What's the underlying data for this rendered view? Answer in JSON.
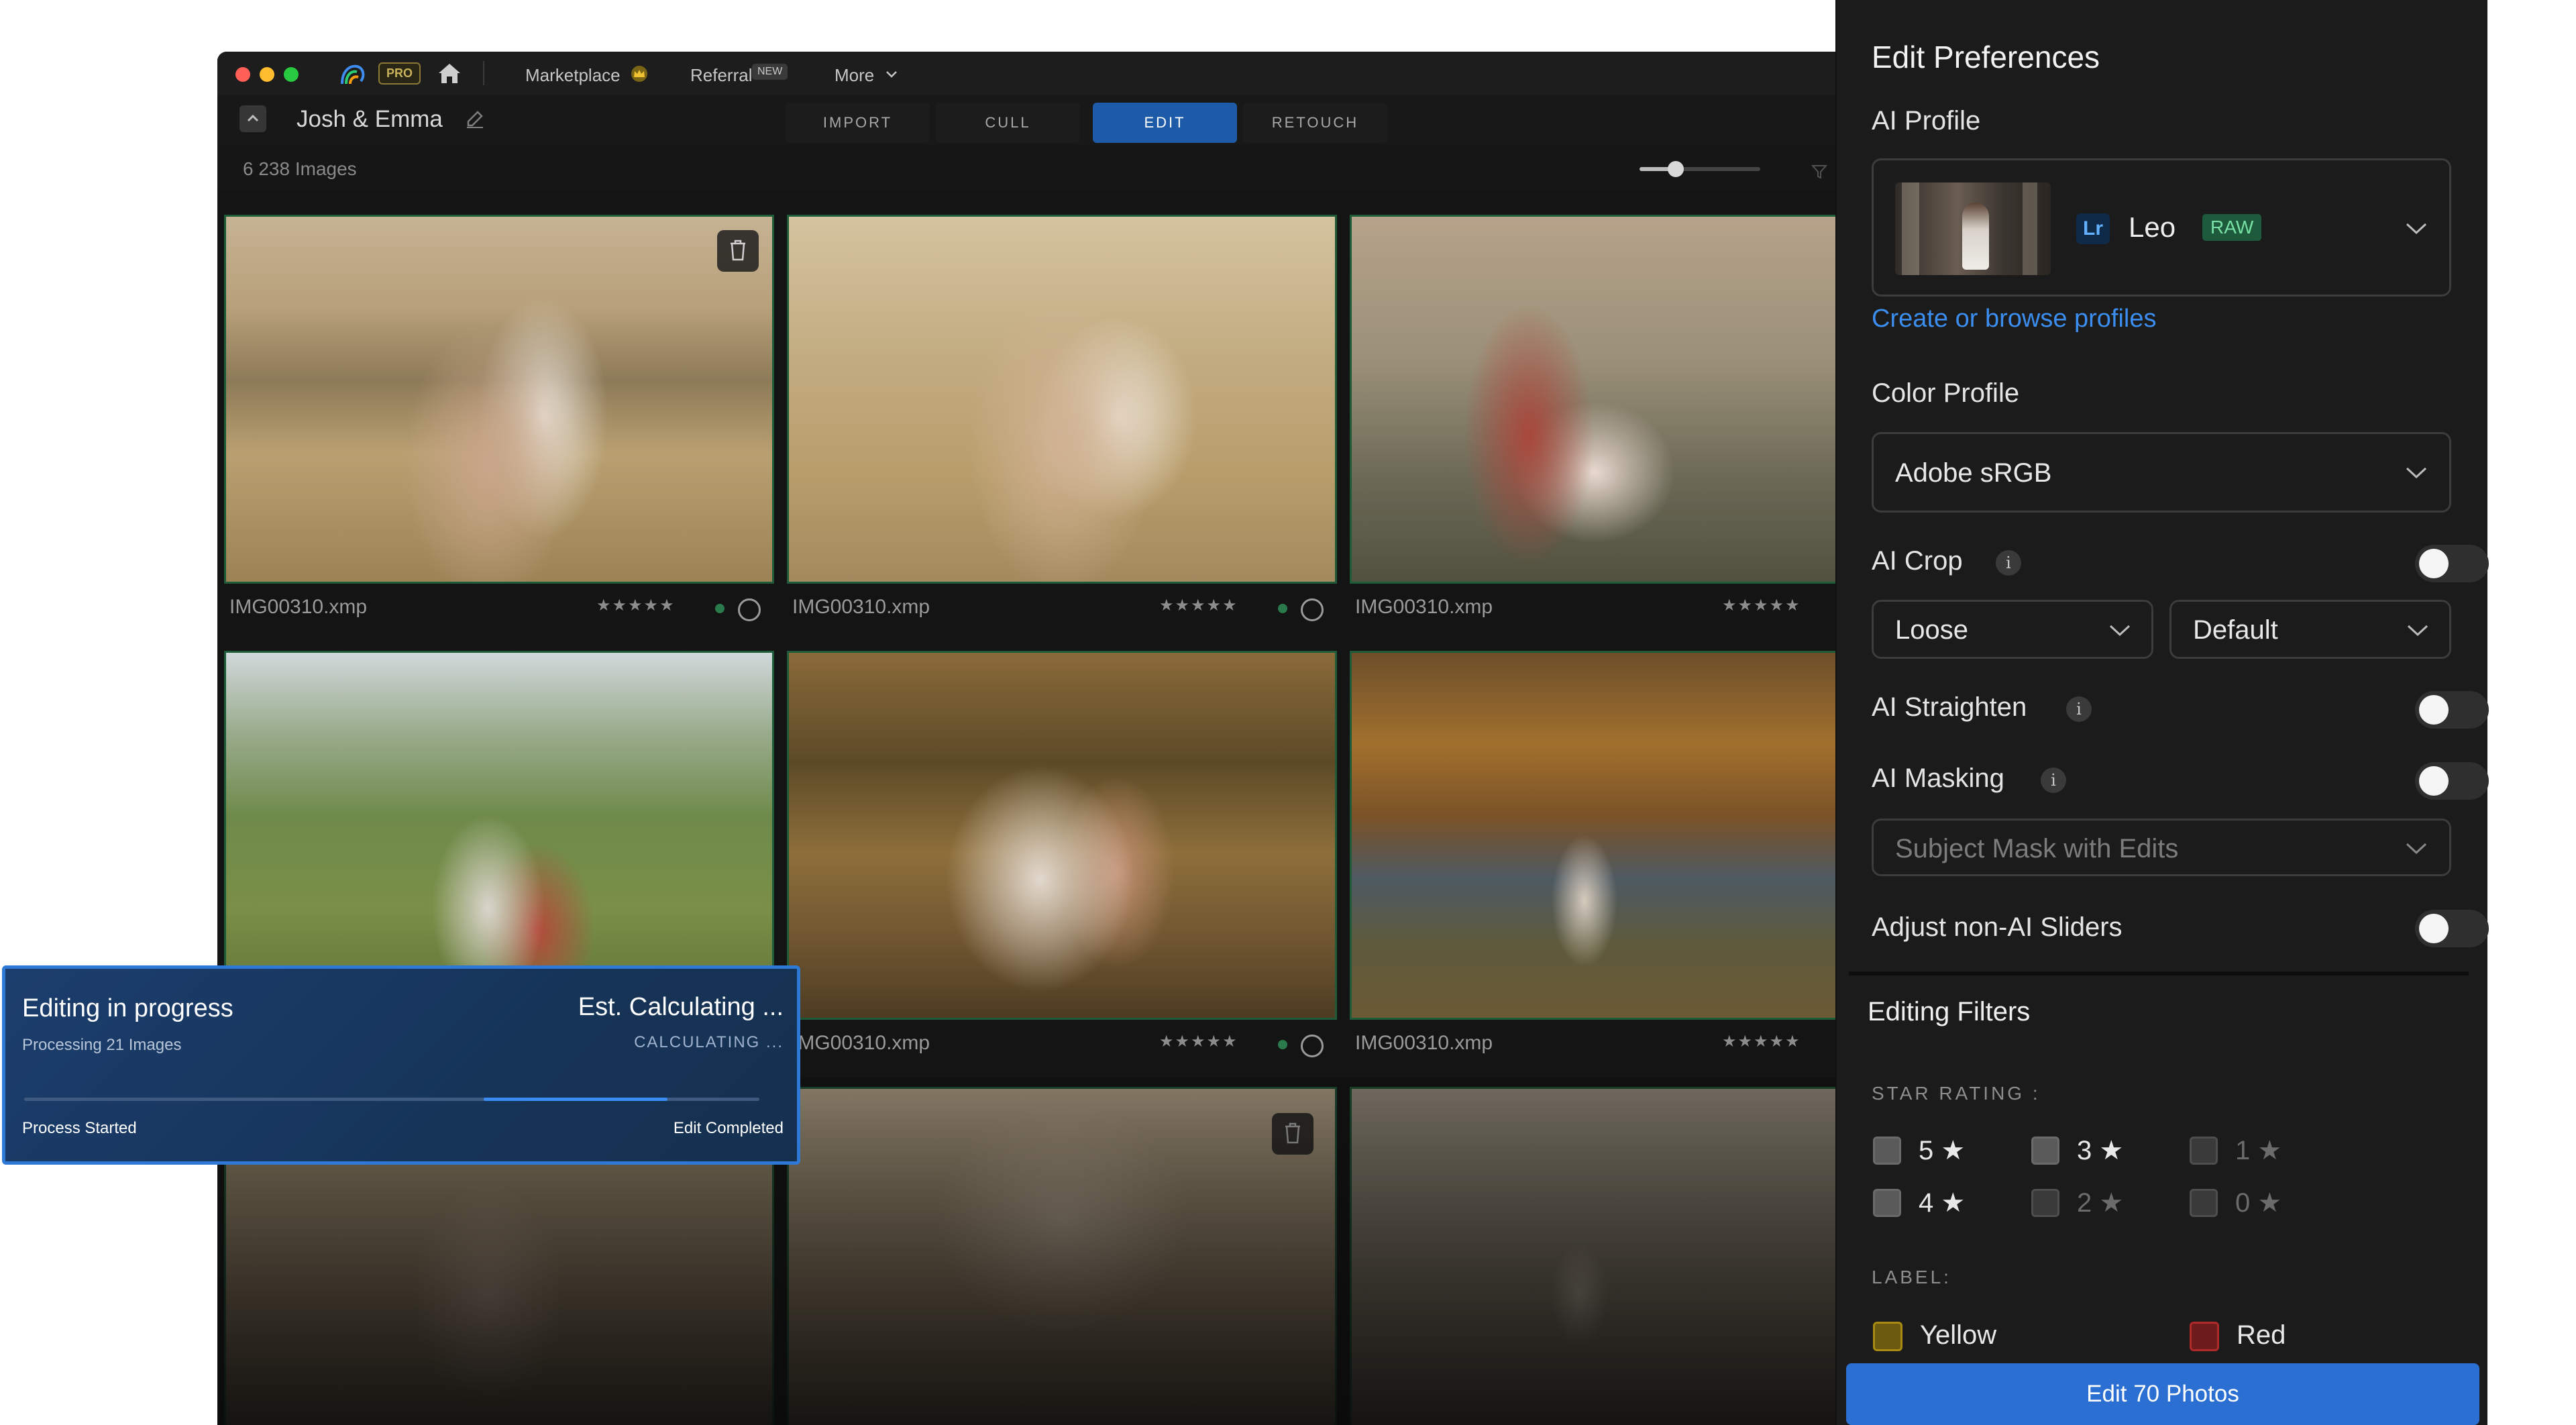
{
  "titlebar": {
    "pro_badge": "PRO",
    "marketplace": "Marketplace",
    "referral": "Referral",
    "new_badge": "NEW",
    "more": "More"
  },
  "header": {
    "album_title": "Josh & Emma",
    "tabs": [
      {
        "label": "IMPORT",
        "active": false
      },
      {
        "label": "CULL",
        "active": false
      },
      {
        "label": "EDIT",
        "active": true
      },
      {
        "label": "RETOUCH",
        "active": false
      }
    ]
  },
  "gallery": {
    "image_count": "6 238 Images",
    "zoom_level": 0.3,
    "photos": [
      {
        "filename": "IMG00310.xmp",
        "stars": "★★★★★"
      },
      {
        "filename": "IMG00310.xmp",
        "stars": "★★★★★"
      },
      {
        "filename": "IMG00310.xmp",
        "stars": "★★★★★"
      },
      {
        "filename": "",
        "stars": ""
      },
      {
        "filename": "IMG00310.xmp",
        "stars": "★★★★★"
      },
      {
        "filename": "IMG00310.xmp",
        "stars": "★★★★★"
      }
    ]
  },
  "toast": {
    "title": "Editing in progress",
    "subtitle": "Processing 21 Images",
    "estimate": "Est. Calculating ...",
    "status": "CALCULATING ...",
    "start_label": "Process Started",
    "end_label": "Edit Completed",
    "progress": 0.25
  },
  "panel": {
    "title": "Edit Preferences",
    "ai_profile": {
      "label": "AI Profile",
      "app_badge": "Lr",
      "name": "Leo",
      "format_badge": "RAW",
      "link": "Create or browse profiles"
    },
    "color_profile": {
      "label": "Color Profile",
      "value": "Adobe sRGB"
    },
    "ai_crop": {
      "label": "AI Crop",
      "enabled": false,
      "crop_type": "Loose",
      "crop_ratio": "Default"
    },
    "ai_straighten": {
      "label": "AI Straighten",
      "enabled": false
    },
    "ai_masking": {
      "label": "AI Masking",
      "enabled": false,
      "mask_option": "Subject Mask with Edits"
    },
    "adjust_sliders": {
      "label": "Adjust non-AI Sliders",
      "enabled": false
    },
    "filters": {
      "title": "Editing Filters",
      "star_heading": "STAR RATING :",
      "star_options": [
        {
          "label": "5",
          "star": "★",
          "enabled": true
        },
        {
          "label": "3",
          "star": "★",
          "enabled": true
        },
        {
          "label": "1",
          "star": "★",
          "enabled": false
        },
        {
          "label": "4",
          "star": "★",
          "enabled": true
        },
        {
          "label": "2",
          "star": "★",
          "enabled": false
        },
        {
          "label": "0",
          "star": "★",
          "enabled": false
        }
      ],
      "label_heading": "LABEL:",
      "labels": [
        {
          "name": "Yellow",
          "color": "#a88a12"
        },
        {
          "name": "Red",
          "color": "#b02a2a"
        }
      ]
    },
    "submit": "Edit 70 Photos"
  },
  "colors": {
    "accent": "#2a6fd1",
    "link": "#3b8ef0",
    "photo_border": "#1f5a39"
  }
}
